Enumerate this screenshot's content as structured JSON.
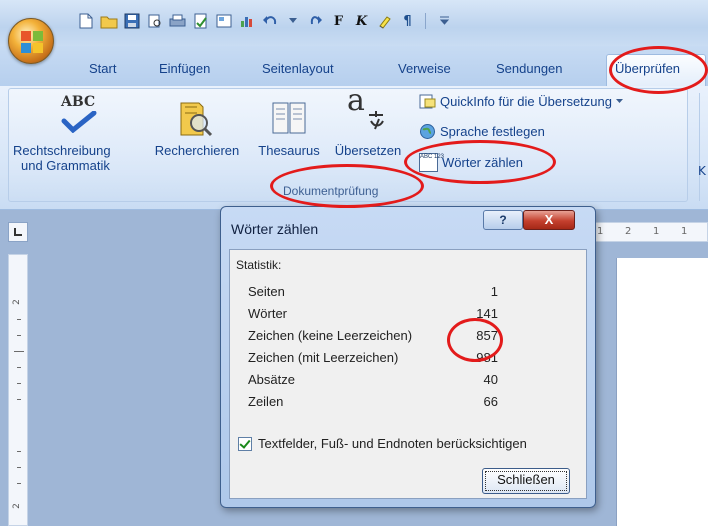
{
  "tabs": [
    {
      "label": "Start"
    },
    {
      "label": "Einfügen"
    },
    {
      "label": "Seitenlayout"
    },
    {
      "label": "Verweise"
    },
    {
      "label": "Sendungen"
    },
    {
      "label": "Überprüfen"
    }
  ],
  "qat": {
    "format_bold": "F",
    "format_italic": "K",
    "pilcrow": "¶"
  },
  "ribbon": {
    "spelling": {
      "icon_text": "ABC",
      "label_line1": "Rechtschreibung",
      "label_line2": "und Grammatik"
    },
    "research": {
      "label": "Recherchieren"
    },
    "thesaurus": {
      "label": "Thesaurus"
    },
    "translate": {
      "icon_text": "a",
      "label": "Übersetzen"
    },
    "quickinfo": {
      "label": "QuickInfo für die Übersetzung"
    },
    "language": {
      "label": "Sprache festlegen"
    },
    "wordcount": {
      "icon_text": "ABC 123",
      "label": "Wörter zählen"
    },
    "group_label": "Dokumentprüfung",
    "cutoff_letter": "K"
  },
  "ruler": {
    "h_marks": [
      "1",
      "2",
      "1",
      "1"
    ],
    "v_marks": [
      "2",
      "2"
    ]
  },
  "dialog": {
    "title": "Wörter zählen",
    "help": "?",
    "close_x": "X",
    "section_label": "Statistik:",
    "stats": [
      {
        "label": "Seiten",
        "value": "1"
      },
      {
        "label": "Wörter",
        "value": "141"
      },
      {
        "label": "Zeichen (keine Leerzeichen)",
        "value": "857"
      },
      {
        "label": "Zeichen (mit Leerzeichen)",
        "value": "981"
      },
      {
        "label": "Absätze",
        "value": "40"
      },
      {
        "label": "Zeilen",
        "value": "66"
      }
    ],
    "include_label": "Textfelder, Fuß- und Endnoten berücksichtigen",
    "close_button": "Schließen"
  },
  "colors": {
    "annotation": "#e31b1b",
    "ribbon_text": "#15428b",
    "close_red": "#c4402e"
  }
}
